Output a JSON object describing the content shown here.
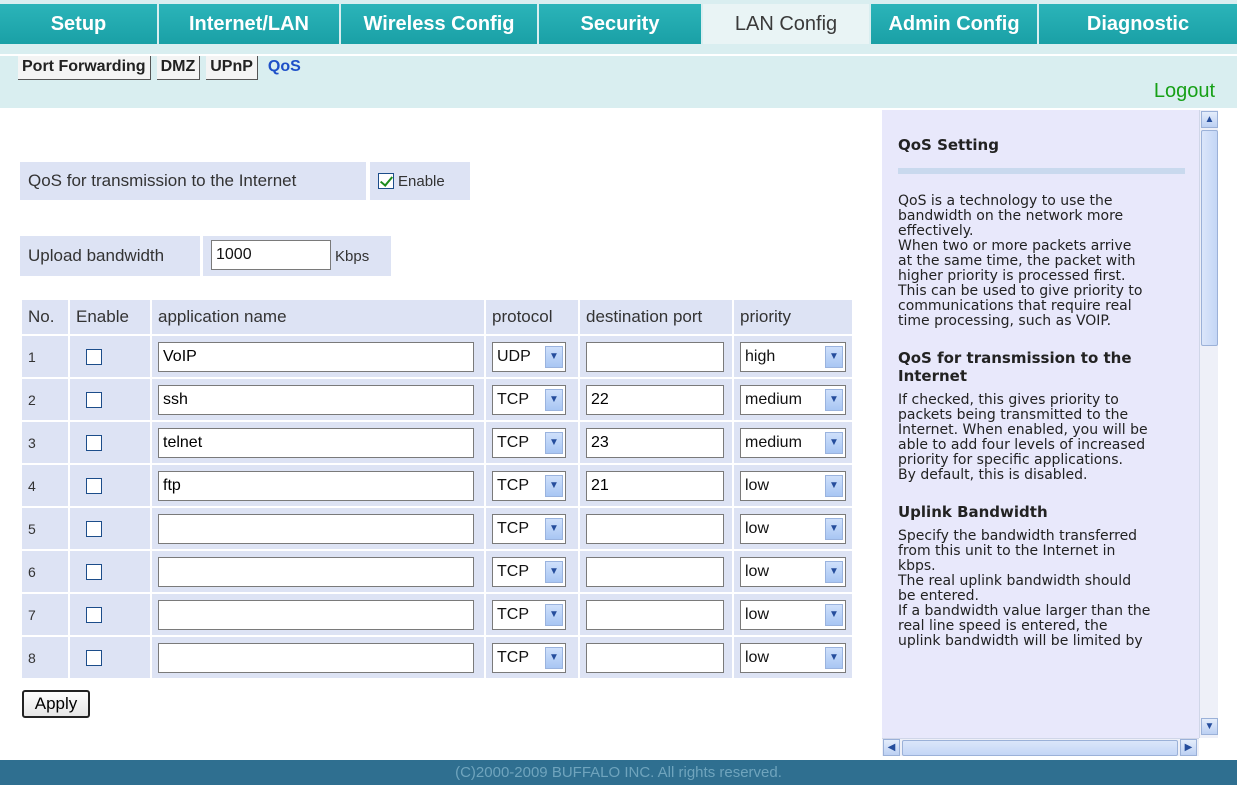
{
  "nav": {
    "tabs": [
      {
        "label": "Setup"
      },
      {
        "label": "Internet/LAN"
      },
      {
        "label": "Wireless Config"
      },
      {
        "label": "Security"
      },
      {
        "label": "LAN Config"
      },
      {
        "label": "Admin Config"
      },
      {
        "label": "Diagnostic"
      }
    ],
    "active": "LAN Config",
    "subtabs": [
      {
        "label": "Port Forwarding"
      },
      {
        "label": "DMZ"
      },
      {
        "label": "UPnP"
      },
      {
        "label": "QoS"
      }
    ],
    "logout": "Logout"
  },
  "qos": {
    "enable_label": "QoS for transmission to the Internet",
    "enable_checkbox_label": "Enable",
    "enable_checked": true,
    "upload_label": "Upload bandwidth",
    "upload_value": "1000",
    "upload_unit": "Kbps",
    "table": {
      "headers": [
        "No.",
        "Enable",
        "application name",
        "protocol",
        "destination port",
        "priority"
      ],
      "rows": [
        {
          "no": "1",
          "enabled": false,
          "app": "VoIP",
          "protocol": "UDP",
          "port": "",
          "priority": "high"
        },
        {
          "no": "2",
          "enabled": false,
          "app": "ssh",
          "protocol": "TCP",
          "port": "22",
          "priority": "medium"
        },
        {
          "no": "3",
          "enabled": false,
          "app": "telnet",
          "protocol": "TCP",
          "port": "23",
          "priority": "medium"
        },
        {
          "no": "4",
          "enabled": false,
          "app": "ftp",
          "protocol": "TCP",
          "port": "21",
          "priority": "low"
        },
        {
          "no": "5",
          "enabled": false,
          "app": "",
          "protocol": "TCP",
          "port": "",
          "priority": "low"
        },
        {
          "no": "6",
          "enabled": false,
          "app": "",
          "protocol": "TCP",
          "port": "",
          "priority": "low"
        },
        {
          "no": "7",
          "enabled": false,
          "app": "",
          "protocol": "TCP",
          "port": "",
          "priority": "low"
        },
        {
          "no": "8",
          "enabled": false,
          "app": "",
          "protocol": "TCP",
          "port": "",
          "priority": "low"
        }
      ]
    },
    "apply_label": "Apply"
  },
  "help": {
    "sections": [
      {
        "title": "QoS Setting",
        "body": "QoS is a technology to use the\nbandwidth on the network more\neffectively.\nWhen two or more packets arrive\nat the same time, the packet with\nhigher priority is processed first.\nThis can be used to give priority to\ncommunications that require real\ntime processing, such as VOIP."
      },
      {
        "title": "QoS for transmission to the Internet",
        "body": "If checked, this gives priority to\npackets being transmitted to the\nInternet. When enabled, you will be\nable to add four levels of increased\npriority for specific applications.\nBy default, this is disabled."
      },
      {
        "title": "Uplink Bandwidth",
        "body": "Specify the bandwidth transferred\nfrom this unit to the Internet in\nkbps.\nThe real uplink bandwidth should\nbe entered.\nIf a bandwidth value larger than the\nreal line speed is entered, the\nuplink bandwidth will be limited by"
      }
    ]
  },
  "footer": "(C)2000-2009 BUFFALO INC. All rights reserved."
}
